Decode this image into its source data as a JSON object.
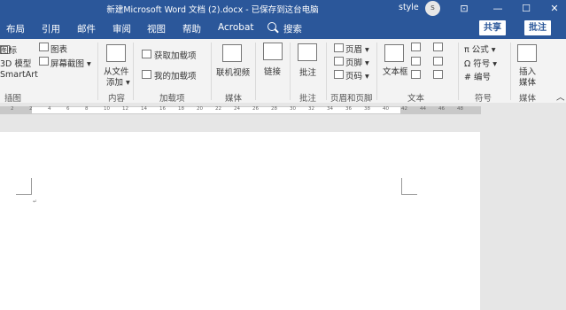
{
  "window": {
    "title": "新建Microsoft Word 文档 (2).docx - 已保存到这台电脑",
    "user": "style",
    "avatar": "s",
    "controls": [
      "⊡",
      "—",
      "☐",
      "✕"
    ]
  },
  "tabs": [
    "布局",
    "引用",
    "邮件",
    "审阅",
    "视图",
    "帮助",
    "Acrobat"
  ],
  "search_label": "搜索",
  "share_label": "共享",
  "comments_label": "批注",
  "ribbon": {
    "illustrations": {
      "items": [
        "图标",
        "3D 模型",
        "SmartArt"
      ],
      "chart": "图表",
      "screenshot": "屏幕截图 ▾",
      "group": "插图"
    },
    "content": {
      "button": "从文件",
      "button2": "添加 ▾",
      "group": "内容"
    },
    "addins": {
      "get": "获取加载项",
      "my": "我的加载项",
      "group": "加载项"
    },
    "media": {
      "button": "联机视频",
      "group": "媒体"
    },
    "links": {
      "button": "链接"
    },
    "comments": {
      "button": "批注",
      "group": "批注"
    },
    "header_footer": {
      "items": [
        "页眉 ▾",
        "页脚 ▾",
        "页码 ▾"
      ],
      "group": "页眉和页脚"
    },
    "text": {
      "textbox": "文本框",
      "group": "文本"
    },
    "symbols": {
      "items": [
        "π 公式 ▾",
        "Ω 符号 ▾",
        "# 编号"
      ],
      "group": "符号"
    },
    "insert_media": {
      "button": "插入",
      "button2": "媒体",
      "group": "媒体"
    }
  },
  "ruler_ticks": [
    "2",
    "2",
    "4",
    "6",
    "8",
    "10",
    "12",
    "14",
    "16",
    "18",
    "20",
    "22",
    "24",
    "26",
    "28",
    "30",
    "32",
    "34",
    "36",
    "38",
    "40",
    "42",
    "44",
    "46",
    "48"
  ]
}
